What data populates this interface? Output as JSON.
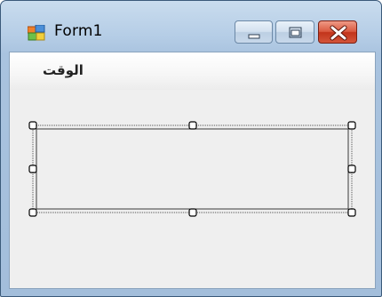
{
  "window": {
    "title": "Form1",
    "icons": {
      "app": "windows-form-icon",
      "minimize": "minimize-icon",
      "maximize": "maximize-icon",
      "close": "close-icon"
    },
    "colors": {
      "frame": "#b5cde6",
      "close_button": "#c2341b",
      "client_background": "#efefef"
    }
  },
  "menu": {
    "items": [
      {
        "label": "الوقت"
      }
    ]
  },
  "designer": {
    "selected_control": "text-box-control"
  }
}
